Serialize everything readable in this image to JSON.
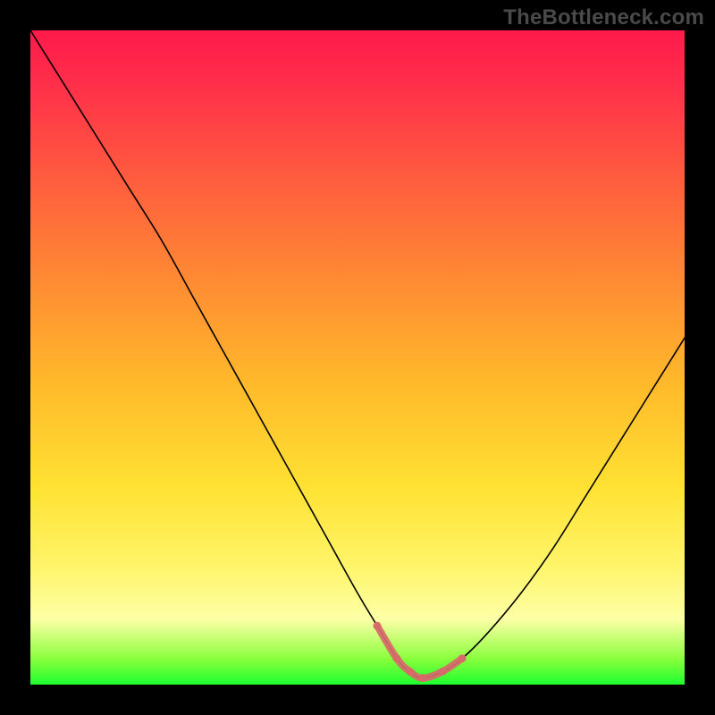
{
  "watermark": "TheBottleneck.com",
  "colors": {
    "background_black": "#000000",
    "gradient_top": "#ff1a4b",
    "gradient_mid1": "#ff8a33",
    "gradient_mid2": "#ffe233",
    "gradient_bottom": "#1dff2f",
    "curve": "#000000",
    "highlight": "#d86a6a"
  },
  "chart_data": {
    "type": "line",
    "title": "",
    "xlabel": "",
    "ylabel": "",
    "xlim": [
      0,
      100
    ],
    "ylim": [
      0,
      100
    ],
    "grid": false,
    "legend": false,
    "series": [
      {
        "name": "bottleneck-curve",
        "x": [
          0,
          5,
          10,
          15,
          20,
          25,
          30,
          35,
          40,
          45,
          50,
          53,
          56,
          58,
          60,
          63,
          66,
          70,
          75,
          80,
          85,
          90,
          95,
          100
        ],
        "y": [
          100,
          92,
          84,
          76,
          68,
          59,
          50,
          41,
          32,
          23,
          14,
          9,
          4,
          2,
          1,
          2,
          4,
          8,
          14,
          21,
          29,
          37,
          45,
          53
        ]
      },
      {
        "name": "bottom-highlight",
        "x": [
          53,
          56,
          58,
          60,
          63,
          66
        ],
        "y": [
          9,
          4,
          2,
          1,
          2,
          4
        ]
      }
    ],
    "annotations": [
      {
        "text": "TheBottleneck.com",
        "role": "watermark"
      }
    ]
  }
}
